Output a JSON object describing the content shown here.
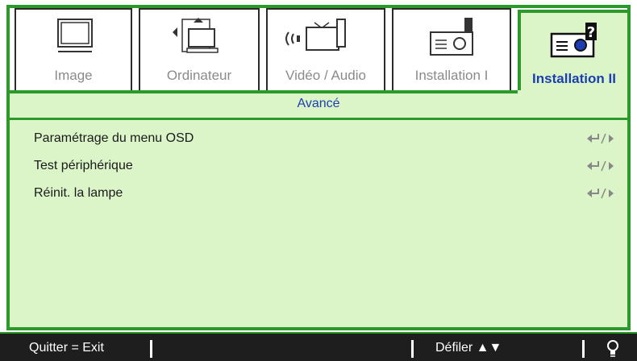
{
  "tabs": [
    {
      "label": "Image",
      "icon": "monitor-icon",
      "active": false
    },
    {
      "label": "Ordinateur",
      "icon": "computer-icon",
      "active": false
    },
    {
      "label": "Vidéo / Audio",
      "icon": "video-audio-icon",
      "active": false
    },
    {
      "label": "Installation I",
      "icon": "projector-icon",
      "active": false
    },
    {
      "label": "Installation II",
      "icon": "projector-question-icon",
      "active": true
    }
  ],
  "section": {
    "title": "Avancé"
  },
  "menu": [
    {
      "label": "Paramétrage du menu OSD"
    },
    {
      "label": "Test périphérique"
    },
    {
      "label": "Réinit. la lampe"
    }
  ],
  "statusbar": {
    "exit": "Quitter = Exit",
    "scroll": "Défiler ▲▼",
    "icon": "lightbulb-icon"
  },
  "colors": {
    "accent_green": "#2b9a2b",
    "panel_green": "#dcf5c8",
    "title_blue": "#1b3fb0",
    "statusbar_bg": "#1e1e1e"
  }
}
